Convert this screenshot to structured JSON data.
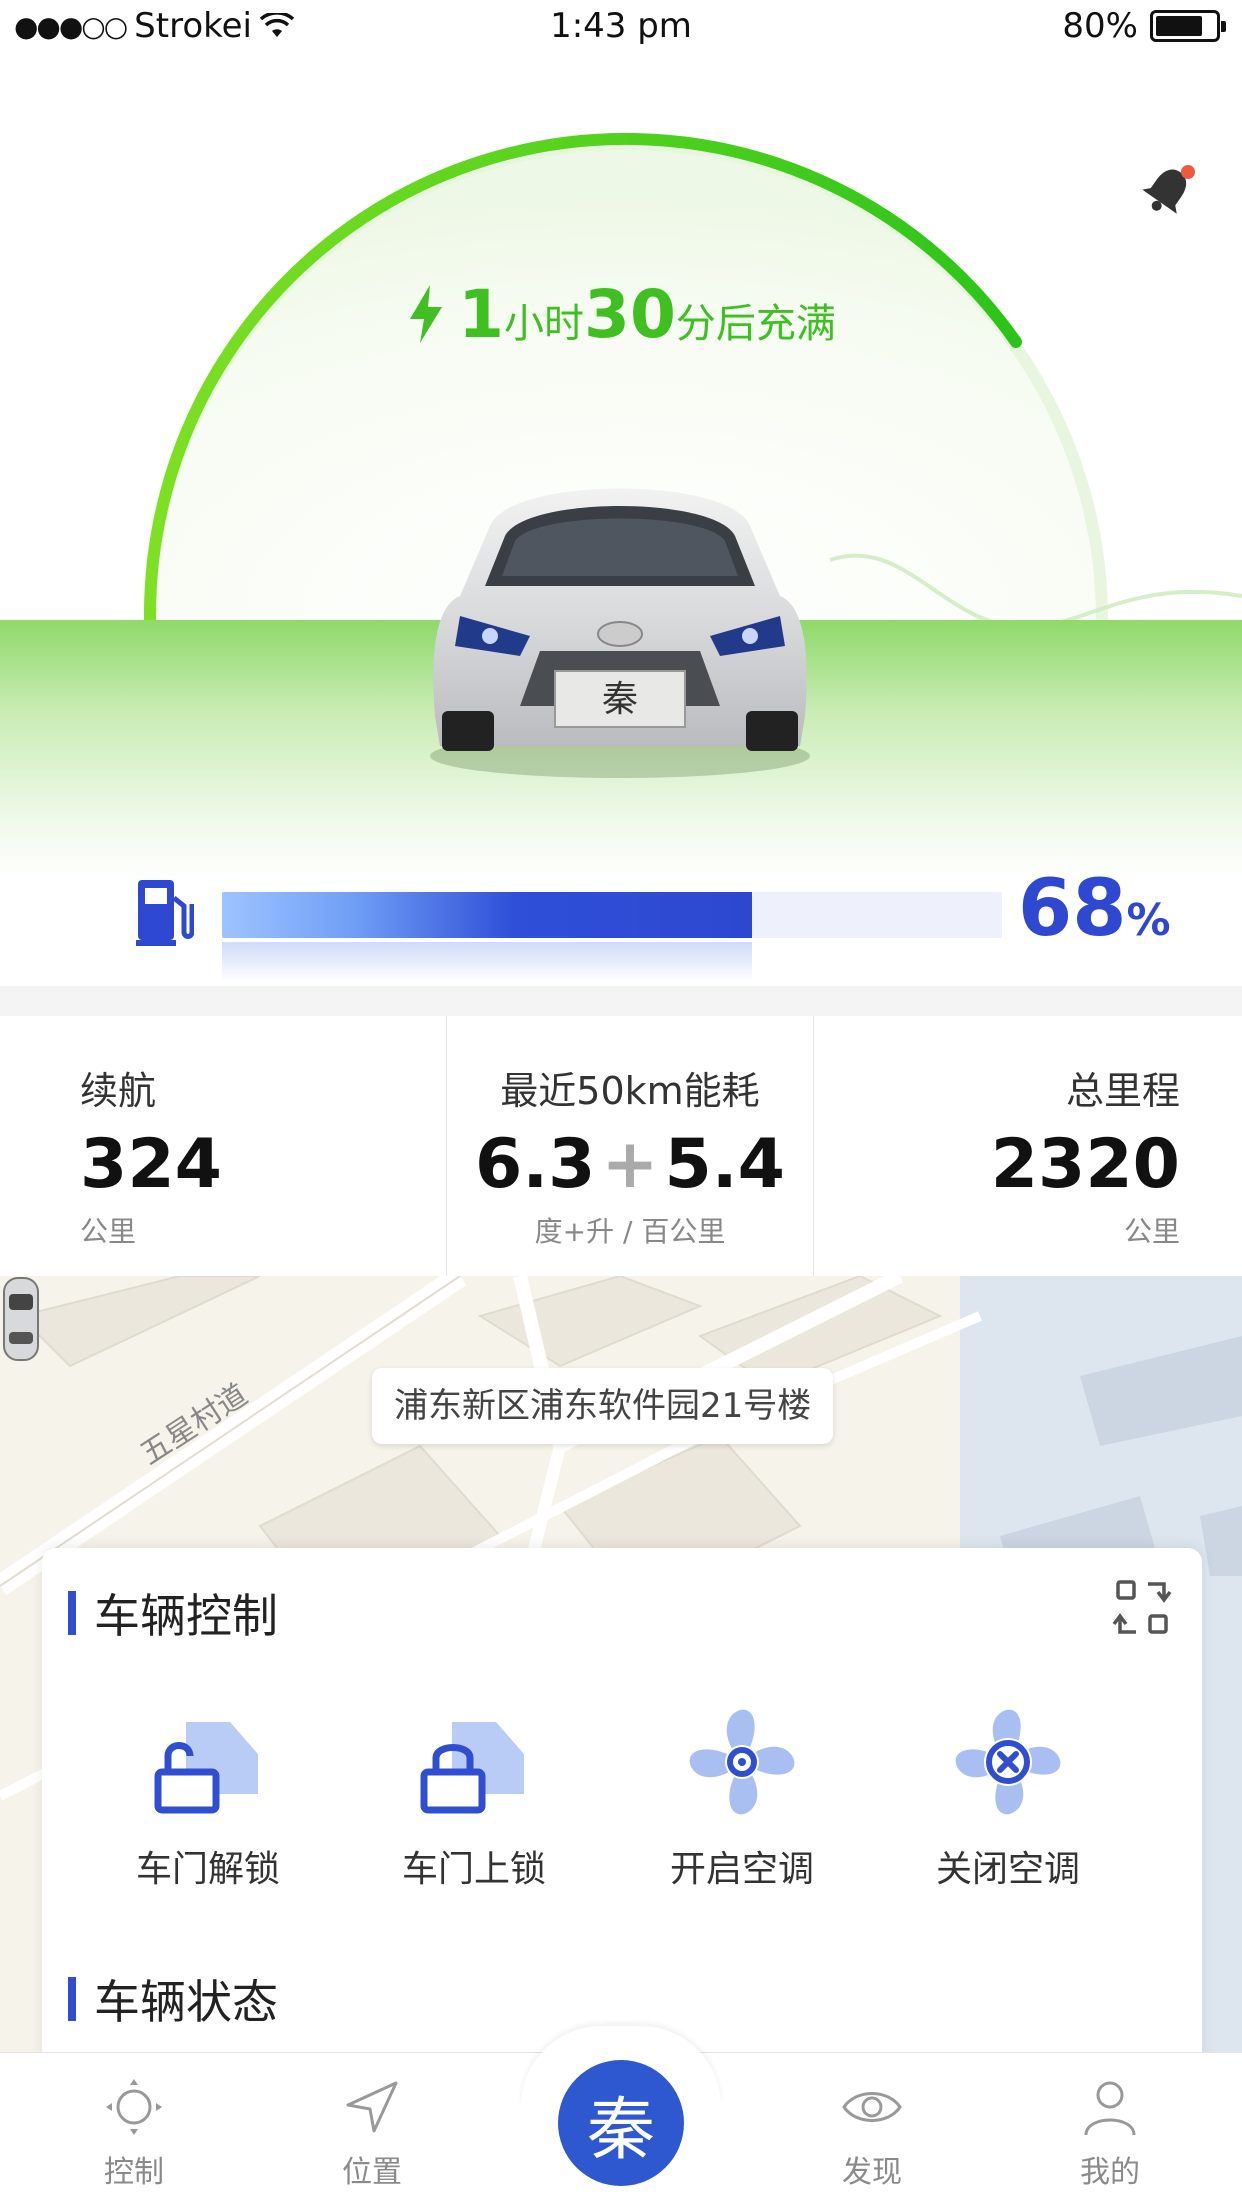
{
  "status_bar": {
    "signal": "●●●○○",
    "carrier": "Strokei",
    "time": "1:43 pm",
    "battery": "80%",
    "battery_level": 0.8
  },
  "charge": {
    "hours": "1",
    "hours_label": "小时",
    "minutes": "30",
    "minutes_label": "分后充满",
    "color": "#3fbf22"
  },
  "car_badge": "秦",
  "fuel": {
    "percent_value": 68,
    "percent": "68",
    "unit": "%",
    "color": "#2f48d1"
  },
  "stats": {
    "range": {
      "label": "续航",
      "value": "324",
      "unit": "公里"
    },
    "consumption": {
      "label": "最近50km能耗",
      "value_a": "6.3",
      "plus": "+",
      "value_b": "5.4",
      "unit": "度+升 / 百公里"
    },
    "mileage": {
      "label": "总里程",
      "value": "2320",
      "unit": "公里"
    }
  },
  "map": {
    "address": "浦东新区浦东软件园21号楼",
    "road": "五星村道"
  },
  "vehicle_control": {
    "title": "车辆控制",
    "items": [
      {
        "label": "车门解锁",
        "icon": "door-unlock-icon"
      },
      {
        "label": "车门上锁",
        "icon": "door-lock-icon"
      },
      {
        "label": "开启空调",
        "icon": "fan-on-icon"
      },
      {
        "label": "关闭空调",
        "icon": "fan-off-icon"
      }
    ],
    "accent": "#2f4fd0"
  },
  "vehicle_status": {
    "title": "车辆状态"
  },
  "tabbar": {
    "tabs": [
      {
        "label": "控制",
        "icon": "control-icon"
      },
      {
        "label": "位置",
        "icon": "location-arrow-icon"
      },
      {
        "label": "发现",
        "icon": "eye-icon"
      },
      {
        "label": "我的",
        "icon": "user-icon"
      }
    ],
    "center": "秦",
    "center_color": "#2e58d0"
  }
}
